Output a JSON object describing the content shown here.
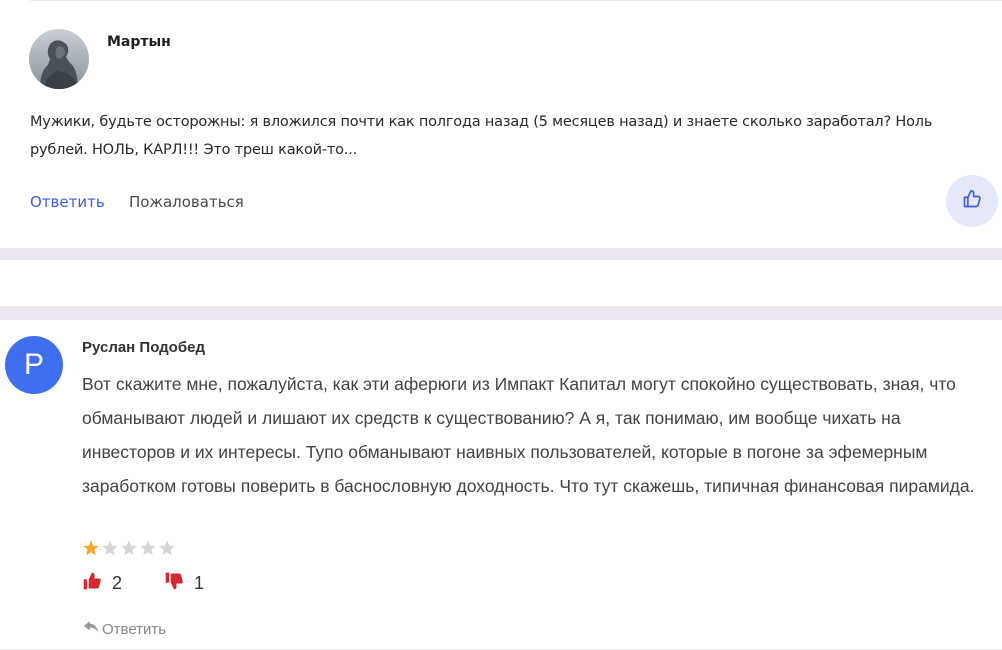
{
  "comment1": {
    "author": "Мартын",
    "text_line1": "Мужики, будьте осторожны: я вложился почти как полгода назад (5 месяцев назад) и знаете сколько заработал? Ноль",
    "text_line2": "рублей. НОЛЬ, КАРЛ!!! Это треш какой-то...",
    "reply_label": "Ответить",
    "report_label": "Пожаловаться",
    "like_icon": "thumbs-up-icon",
    "accent_color": "#3d5ce6"
  },
  "comment2": {
    "author": "Руслан Подобед",
    "avatar_letter": "Р",
    "avatar_color": "#3f6ef0",
    "text": "Вот скажите мне, пожалуйста, как эти аферюги из Импакт Капитал могут спокойно существовать, зная, что обманывают людей и лишают их средств к существованию? А я, так понимаю, им вообще чихать на инвесторов и их интересы. Тупо обманывают наивных пользователей, которые в погоне за эфемерным заработком готовы поверить в баснословную доходность. Что тут скажешь, типичная финансовая пирамида.",
    "rating": 1,
    "rating_max": 5,
    "likes": "2",
    "dislikes": "1",
    "vote_color": "#d8282f",
    "reply_label": "Ответить"
  }
}
